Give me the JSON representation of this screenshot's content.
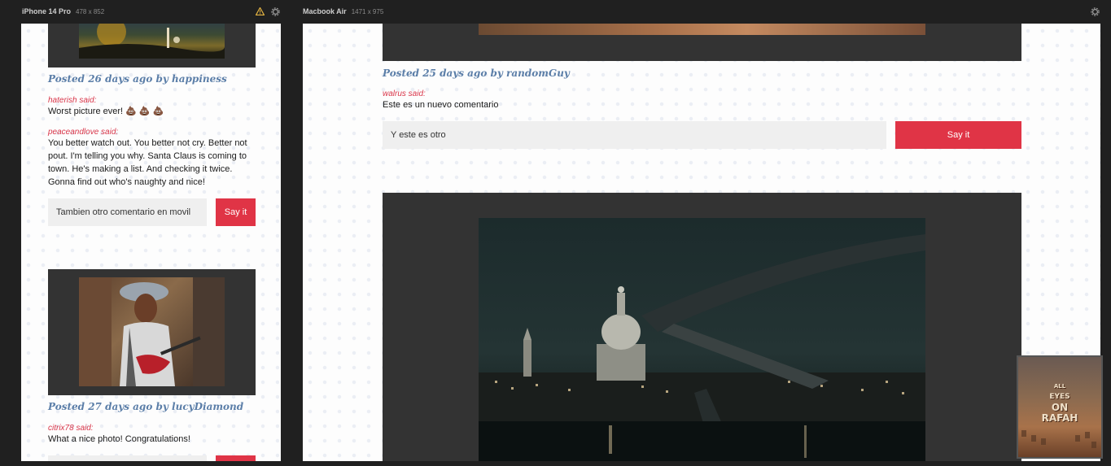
{
  "devices": {
    "phone": {
      "name": "iPhone 14 Pro",
      "dims": "478 x 852"
    },
    "laptop": {
      "name": "Macbook Air",
      "dims": "1471 x 975"
    }
  },
  "icons": {
    "warning": "warning-icon",
    "settings": "gear-icon"
  },
  "colors": {
    "accent": "#e03446",
    "meta": "#5b7ea8",
    "username": "#d9364a",
    "frame": "#333333"
  },
  "phone_feed": {
    "post1": {
      "meta": "Posted 26 days ago by happiness",
      "comments": [
        {
          "user": "haterish said:",
          "text": "Worst picture ever! 💩 💩 💩"
        },
        {
          "user": "peaceandlove said:",
          "text": "You better watch out. You better not cry. Better not pout. I'm telling you why. Santa Claus is coming to town. He's making a list. And checking it twice. Gonna find out who's naughty and nice!"
        }
      ],
      "input_value": "Tambien otro comentario en movil",
      "say_label": "Say it"
    },
    "post2": {
      "meta": "Posted 27 days ago by lucyDiamond",
      "comments": [
        {
          "user": "citrix78 said:",
          "text": "What a nice photo! Congratulations!"
        }
      ]
    }
  },
  "laptop_feed": {
    "post1": {
      "meta": "Posted 25 days ago by randomGuy",
      "comments": [
        {
          "user": "walrus said:",
          "text": "Este es un nuevo comentario"
        }
      ],
      "input_value": "Y este es otro",
      "say_label": "Say it"
    }
  },
  "pip_thumbnail": {
    "line1": "ALL",
    "line2": "EYES",
    "line3": "ON",
    "line4": "RAFAH"
  }
}
